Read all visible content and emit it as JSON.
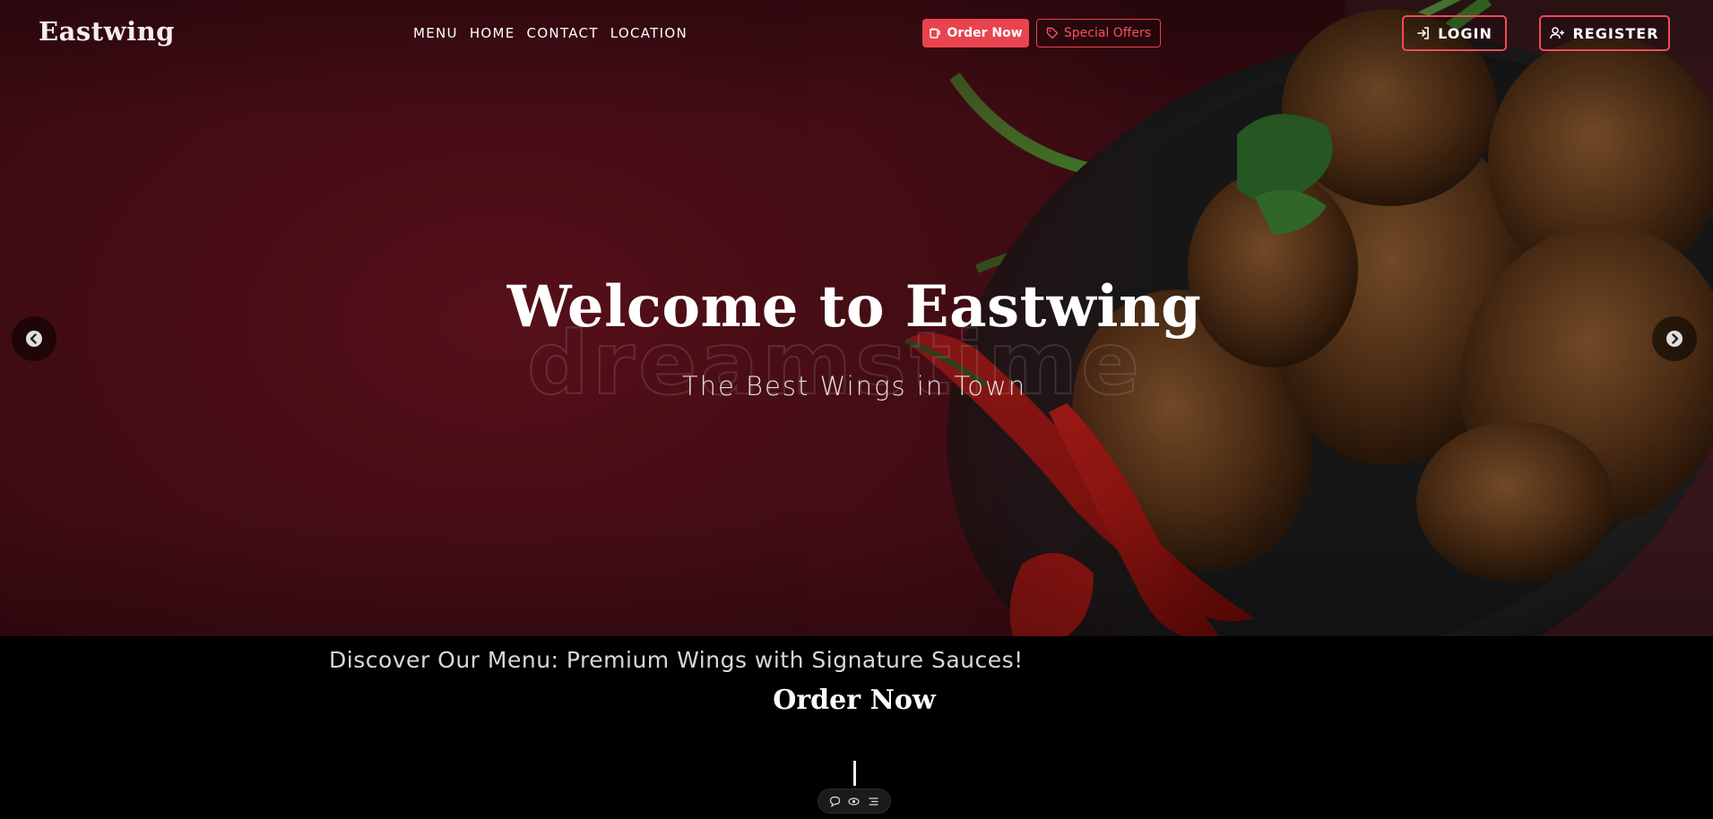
{
  "brand": "Eastwing",
  "nav": [
    "MENU",
    "HOME",
    "CONTACT",
    "LOCATION"
  ],
  "buttons": {
    "order_now": "Order Now",
    "special_offers": "Special Offers",
    "login": "LOGIN",
    "register": "REGISTER"
  },
  "hero": {
    "title": "Welcome to Eastwing",
    "subtitle": "The Best Wings in Town",
    "watermark": "dreamstime"
  },
  "section": {
    "discover": "Discover Our Menu: Premium Wings with Signature Sauces!",
    "order_heading": "Order Now"
  },
  "icons": {
    "order": "cup-icon",
    "offers": "tag-icon",
    "login": "login-arrow-icon",
    "register": "user-plus-icon",
    "prev": "chevron-left-icon",
    "next": "chevron-right-icon",
    "toolbar": [
      "comment-icon",
      "eye-icon",
      "list-icon"
    ]
  },
  "colors": {
    "accent": "#e9434f",
    "hero_bg": "#55101a",
    "section_bg": "#000000"
  }
}
